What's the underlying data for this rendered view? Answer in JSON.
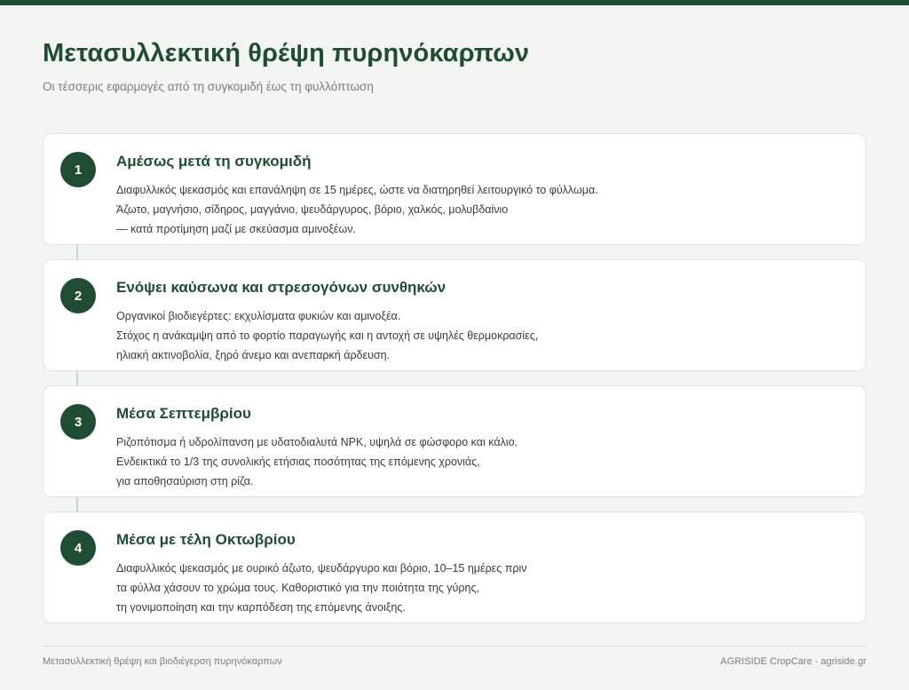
{
  "header": {
    "title": "Μετασυλλεκτική θρέψη πυρηνόκαρπων",
    "subtitle": "Οι τέσσερις εφαρμογές από τη συγκομιδή έως τη φυλλόπτωση"
  },
  "steps": [
    {
      "number": "1",
      "title": "Αμέσως μετά τη συγκομιδή",
      "lines": [
        "Διαφυλλικός ψεκασμός και επανάληψη σε 15 ημέρες, ώστε να διατηρηθεί λειτουργικό το φύλλωμα.",
        "Άζωτο, μαγνήσιο, σίδηρος, μαγγάνιο, ψευδάργυρος, βόριο, χαλκός, μολυβδαίνιο",
        "— κατά προτίμηση μαζί με σκεύασμα αμινοξέων."
      ]
    },
    {
      "number": "2",
      "title": "Ενόψει καύσωνα και στρεσογόνων συνθηκών",
      "lines": [
        "Οργανικοί βιοδιεγέρτες: εκχυλίσματα φυκιών και αμινοξέα.",
        "Στόχος η ανάκαμψη από το φορτίο παραγωγής και η αντοχή σε υψηλές θερμοκρασίες,",
        "ηλιακή ακτινοβολία, ξηρό άνεμο και ανεπαρκή άρδευση."
      ]
    },
    {
      "number": "3",
      "title": "Μέσα Σεπτεμβρίου",
      "lines": [
        "Ριζοπότισμα ή υδρολίπανση με υδατοδιαλυτά NPK, υψηλά σε φώσφορο και κάλιο.",
        "Ενδεικτικά το 1/3 της συνολικής ετήσιας ποσότητας της επόμενης χρονιάς,",
        "για αποθησαύριση στη ρίζα."
      ]
    },
    {
      "number": "4",
      "title": "Μέσα με τέλη Οκτωβρίου",
      "lines": [
        "Διαφυλλικός ψεκασμός με ουρικό άζωτο, ψευδάργυρο και βόριο, 10–15 ημέρες πριν",
        "τα φύλλα χάσουν το χρώμα τους. Καθοριστικό για την ποιότητα της γύρης,",
        "τη γονιμοποίηση και την καρπόδεση της επόμενης άνοιξης."
      ]
    }
  ],
  "footer": {
    "left": "Μετασυλλεκτική θρέψη και βιοδιέγερση πυρηνόκαρπων",
    "right": "AGRISIDE CropCare · agriside.gr"
  },
  "colors": {
    "accent": "#1f4d34",
    "background": "#f3f5f2",
    "card": "#ffffff"
  }
}
